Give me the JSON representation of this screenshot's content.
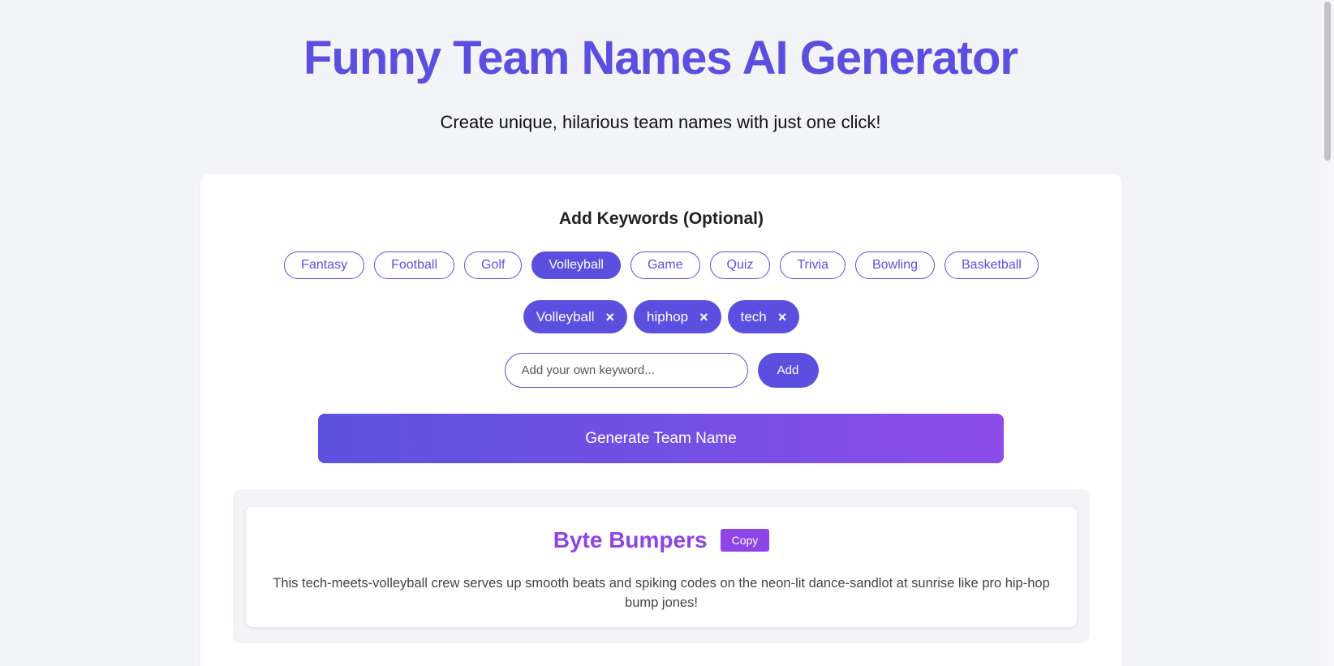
{
  "header": {
    "title": "Funny Team Names AI Generator",
    "subtitle": "Create unique, hilarious team names with just one click!"
  },
  "keywords": {
    "heading": "Add Keywords (Optional)",
    "presets": [
      {
        "label": "Fantasy",
        "active": false
      },
      {
        "label": "Football",
        "active": false
      },
      {
        "label": "Golf",
        "active": false
      },
      {
        "label": "Volleyball",
        "active": true
      },
      {
        "label": "Game",
        "active": false
      },
      {
        "label": "Quiz",
        "active": false
      },
      {
        "label": "Trivia",
        "active": false
      },
      {
        "label": "Bowling",
        "active": false
      },
      {
        "label": "Basketball",
        "active": false
      }
    ],
    "selected": [
      {
        "label": "Volleyball",
        "remove_glyph": "×"
      },
      {
        "label": "hiphop",
        "remove_glyph": "×"
      },
      {
        "label": "tech",
        "remove_glyph": "×"
      }
    ],
    "input": {
      "value": "",
      "placeholder": "Add your own keyword..."
    },
    "add_label": "Add"
  },
  "generate_label": "Generate Team Name",
  "result": {
    "name": "Byte Bumpers",
    "copy_label": "Copy",
    "description": "This tech-meets-volleyball crew serves up smooth beats and spiking codes on the neon-lit dance-sandlot at sunrise like pro hip-hop bump jones!"
  },
  "colors": {
    "accent": "#5b4fe0",
    "result_accent": "#8e44e6",
    "background": "#f3f4f8"
  }
}
